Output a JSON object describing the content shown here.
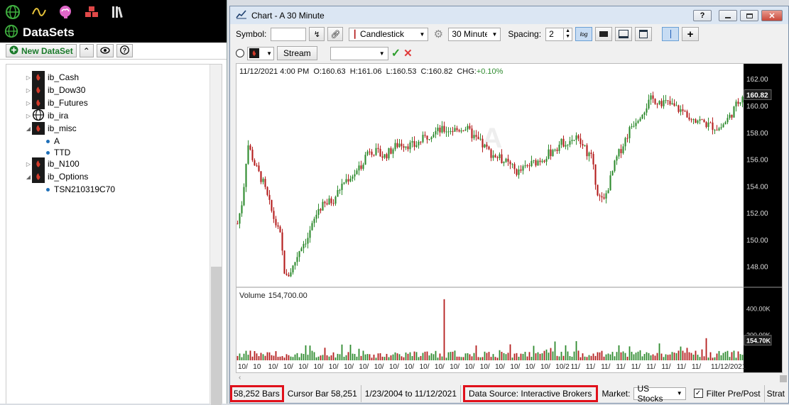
{
  "colors": {
    "up": "#2e8b2e",
    "down": "#b41d1d",
    "accent": "#1a7a2a",
    "highlight": "#e0101a"
  },
  "topbar": {
    "icons": [
      "globe-icon",
      "wave-icon",
      "brain-icon",
      "blocks-icon",
      "books-icon"
    ]
  },
  "datasets": {
    "title": "DataSets",
    "new_label": "New DataSet",
    "tree": [
      {
        "label": "ib_Cash",
        "kind": "dataset",
        "expanded": false
      },
      {
        "label": "ib_Dow30",
        "kind": "dataset",
        "expanded": false
      },
      {
        "label": "ib_Futures",
        "kind": "dataset",
        "expanded": false
      },
      {
        "label": "ib_ira",
        "kind": "globe",
        "expanded": false
      },
      {
        "label": "ib_misc",
        "kind": "dataset",
        "expanded": true
      },
      {
        "label": "A",
        "kind": "symbol"
      },
      {
        "label": "TTD",
        "kind": "symbol"
      },
      {
        "label": "ib_N100",
        "kind": "dataset",
        "expanded": false
      },
      {
        "label": "ib_Options",
        "kind": "dataset",
        "expanded": true
      },
      {
        "label": "TSN210319C70",
        "kind": "symbol"
      }
    ]
  },
  "window": {
    "title": "Chart - A 30 Minute",
    "help_label": "?"
  },
  "toolbar": {
    "symbol_label": "Symbol:",
    "symbol_value": "",
    "chart_style": "Candlestick",
    "interval": "30 Minute",
    "spacing_label": "Spacing:",
    "spacing_value": "2",
    "log_label": "log",
    "stream_label": "Stream",
    "strategy_value": ""
  },
  "chart_data": {
    "type": "candlestick",
    "title": "A",
    "ohlc_caption": {
      "date": "11/12/2021 4:00 PM",
      "open_label": "O:",
      "open": "160.63",
      "high_label": "H:",
      "high": "161.06",
      "low_label": "L:",
      "low": "160.53",
      "close_label": "C:",
      "close": "160.82",
      "chg_label": "CHG:",
      "chg": "+0.10%"
    },
    "price_ticks": [
      "162.00",
      "160.00",
      "158.00",
      "156.00",
      "154.00",
      "152.00",
      "150.00",
      "148.00"
    ],
    "price_range": [
      146.5,
      162.7
    ],
    "last_price": "160.82",
    "price_path": [
      [
        0,
        151.2
      ],
      [
        0.01,
        153.0
      ],
      [
        0.02,
        157.2
      ],
      [
        0.035,
        155.5
      ],
      [
        0.05,
        154.3
      ],
      [
        0.07,
        151.8
      ],
      [
        0.085,
        150.2
      ],
      [
        0.095,
        147.0
      ],
      [
        0.11,
        148.0
      ],
      [
        0.125,
        149.5
      ],
      [
        0.14,
        150.2
      ],
      [
        0.16,
        152.3
      ],
      [
        0.19,
        153.0
      ],
      [
        0.21,
        154.3
      ],
      [
        0.24,
        155.2
      ],
      [
        0.26,
        156.8
      ],
      [
        0.29,
        156.2
      ],
      [
        0.32,
        157.2
      ],
      [
        0.35,
        157.0
      ],
      [
        0.385,
        158.0
      ],
      [
        0.41,
        158.2
      ],
      [
        0.435,
        158.2
      ],
      [
        0.45,
        158.4
      ],
      [
        0.47,
        157.6
      ],
      [
        0.5,
        156.5
      ],
      [
        0.53,
        155.8
      ],
      [
        0.555,
        155.0
      ],
      [
        0.58,
        155.6
      ],
      [
        0.61,
        156.2
      ],
      [
        0.64,
        157.2
      ],
      [
        0.67,
        157.6
      ],
      [
        0.7,
        156.2
      ],
      [
        0.715,
        153.2
      ],
      [
        0.725,
        152.8
      ],
      [
        0.75,
        156.0
      ],
      [
        0.78,
        158.5
      ],
      [
        0.8,
        159.5
      ],
      [
        0.82,
        160.5
      ],
      [
        0.85,
        160.2
      ],
      [
        0.88,
        159.6
      ],
      [
        0.9,
        159.2
      ],
      [
        0.93,
        158.6
      ],
      [
        0.955,
        158.3
      ],
      [
        0.975,
        159.2
      ],
      [
        1.0,
        160.82
      ]
    ],
    "volume_label": "Volume",
    "volume_value": "154,700.00",
    "volume_ticks": [
      "400.00K",
      "200.00K"
    ],
    "volume_range": [
      0,
      480000
    ],
    "last_volume": "154.70K",
    "volume_spike": 0.41,
    "x_ticks": [
      "10/",
      "10",
      "10/",
      "10/",
      "10/",
      "10/",
      "10/",
      "10/",
      "10/",
      "10/",
      "10/",
      "10/",
      "10/",
      "10/",
      "10/",
      "10/",
      "10/",
      "10/",
      "10/",
      "10/",
      "10/",
      "10/2",
      "11/",
      "11/",
      "11/",
      "11/",
      "11/",
      "11/",
      "11/",
      "11/",
      "11/",
      "11/12/2021"
    ]
  },
  "status": {
    "bars": "58,252 Bars",
    "cursor": "Cursor Bar 58,251",
    "range": "1/23/2004 to 11/12/2021",
    "source": "Data Source: Interactive Brokers",
    "market_label": "Market:",
    "market_value": "US Stocks",
    "filter_label": "Filter Pre/Post",
    "extra": "Strat"
  }
}
